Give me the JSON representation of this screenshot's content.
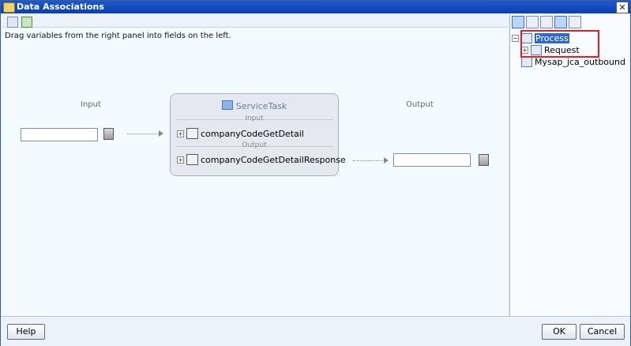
{
  "window": {
    "title": "Data Associations",
    "close_glyph": "✕"
  },
  "instruction": "Drag variables from the right panel into fields on the left.",
  "left": {
    "input_label": "Input",
    "output_label": "Output",
    "input_value": "",
    "output_value": ""
  },
  "service": {
    "title": "ServiceTask",
    "input_divider": "Input",
    "output_divider": "Output",
    "input_item": "companyCodeGetDetail",
    "output_item": "companyCodeGetDetailResponse"
  },
  "tree": {
    "items": [
      {
        "label": "Process",
        "expander": "⊟"
      },
      {
        "label": "Request",
        "expander": "⊞"
      },
      {
        "label": "Mysap_jca_outbound"
      }
    ]
  },
  "buttons": {
    "help": "Help",
    "ok": "OK",
    "cancel": "Cancel"
  }
}
